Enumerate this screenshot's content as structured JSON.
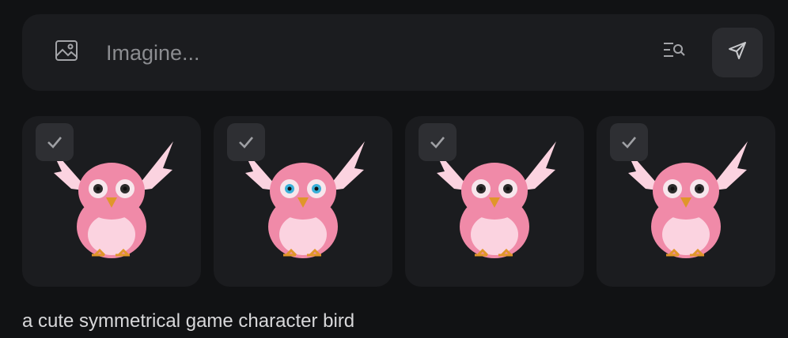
{
  "prompt": {
    "placeholder": "Imagine..."
  },
  "icons": {
    "image_upload": "image-icon",
    "search": "search-list-icon",
    "send": "send-icon",
    "check": "check-icon"
  },
  "results": [
    {
      "eye_color": "#2b2b2b"
    },
    {
      "eye_color": "#3ab0d8"
    },
    {
      "eye_color": "#2b2b2b"
    },
    {
      "eye_color": "#2b2b2b"
    }
  ],
  "caption": "a cute symmetrical game character bird",
  "colors": {
    "background": "#111214",
    "panel": "#1b1c1f",
    "bird_body": "#f08aa8",
    "bird_light": "#fbd3e0",
    "beak": "#e0962a"
  }
}
